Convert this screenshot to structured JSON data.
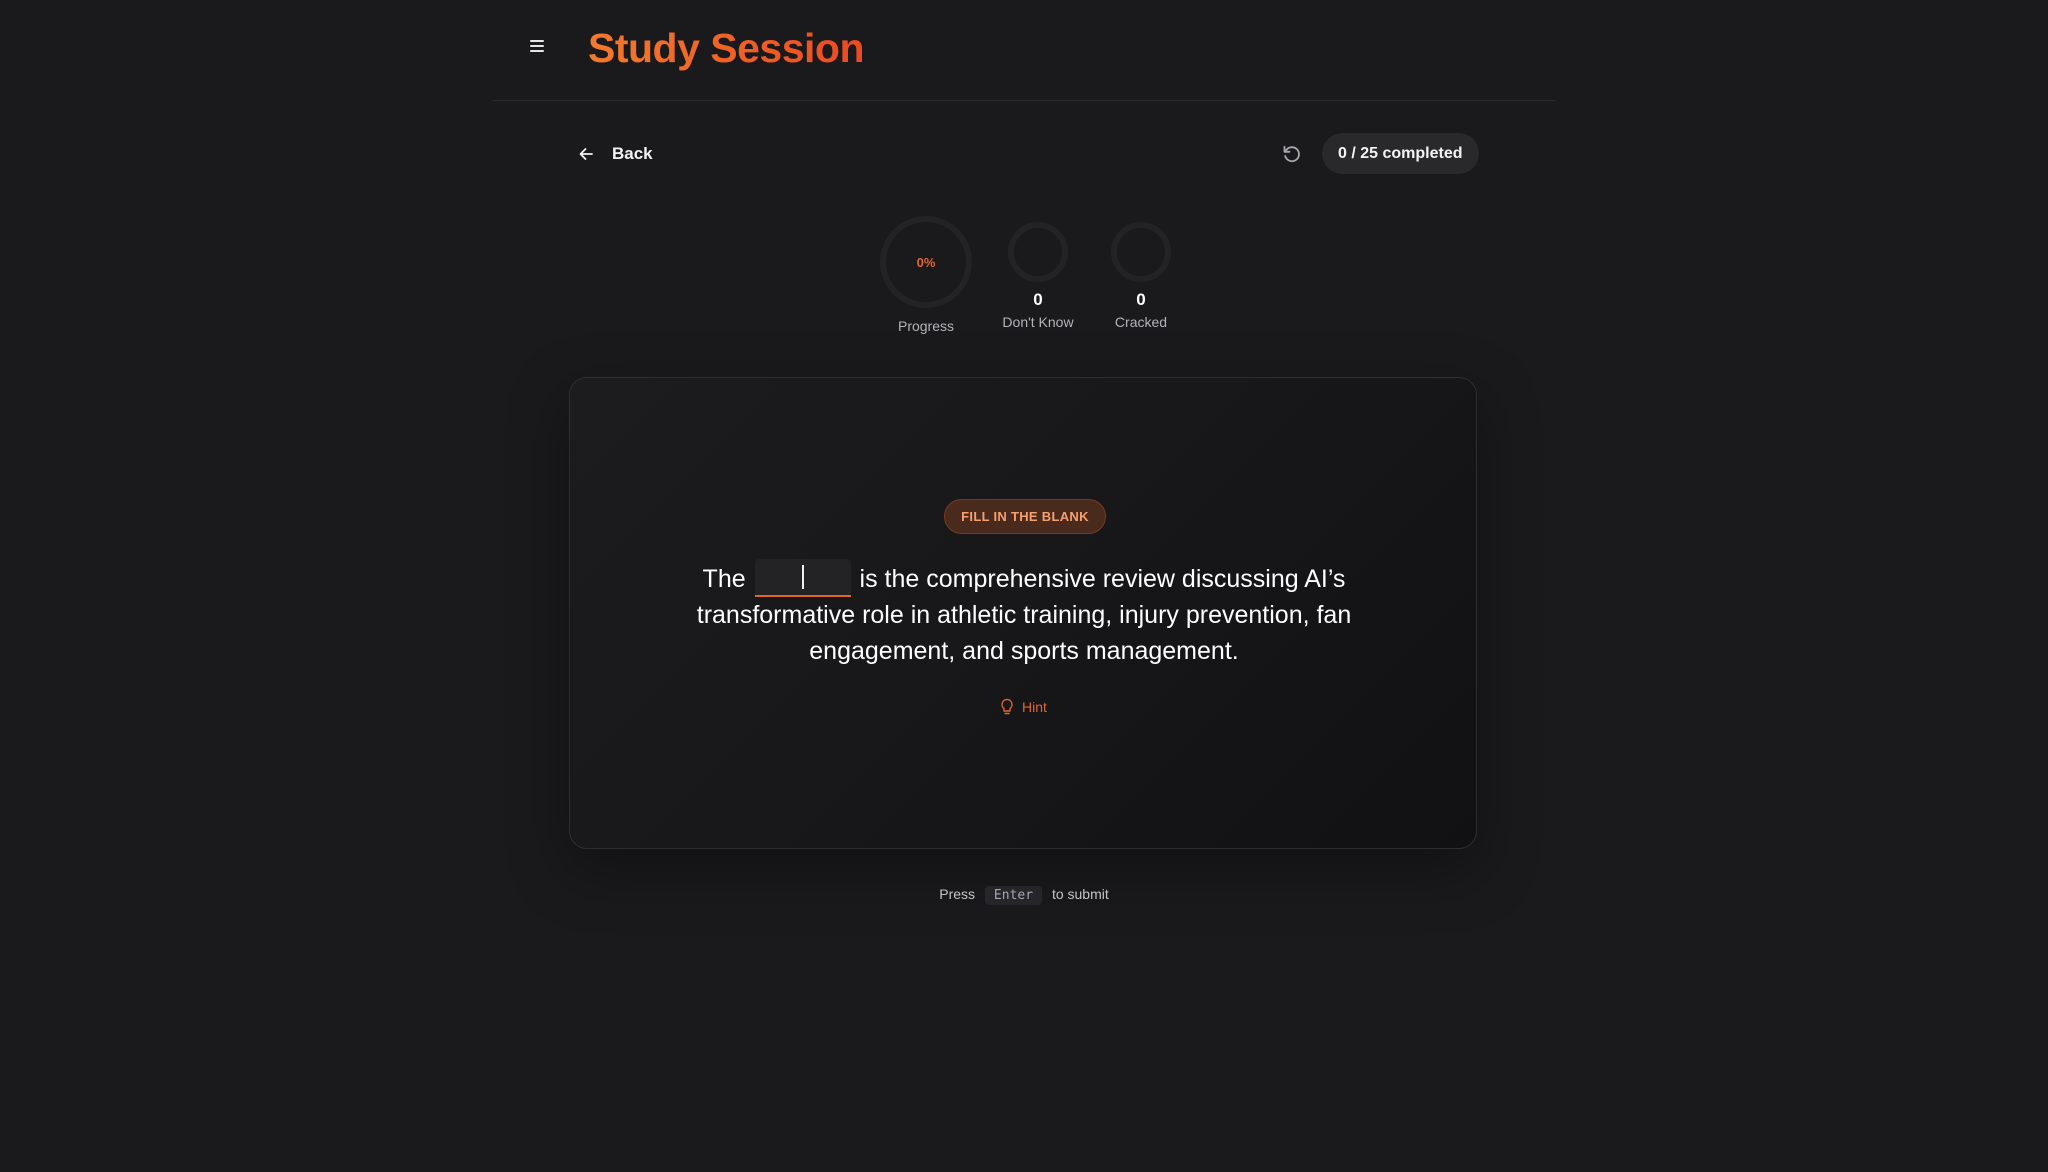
{
  "header": {
    "title": "Study Session",
    "menu_icon": "hamburger-menu-icon"
  },
  "toolbar": {
    "back_label": "Back",
    "reset_icon": "reset-icon",
    "completed_label": "0 / 25 completed"
  },
  "stats": {
    "progress": {
      "value": "0%",
      "label": "Progress",
      "fraction": 0
    },
    "dont_know": {
      "value": "0",
      "label": "Don't Know"
    },
    "cracked": {
      "value": "0",
      "label": "Cracked"
    }
  },
  "card": {
    "badge": "FILL IN THE BLANK",
    "question_before": "The",
    "question_after": "is the comprehensive review discussing AI’s transformative role in athletic training, injury prevention, fan engagement, and sports management.",
    "answer_value": "",
    "hint_label": "Hint"
  },
  "footer": {
    "press": "Press",
    "key": "Enter",
    "action": "to submit"
  },
  "colors": {
    "accent": "#e0652c",
    "background": "#1a1a1c",
    "badge_text": "#f4a070"
  }
}
